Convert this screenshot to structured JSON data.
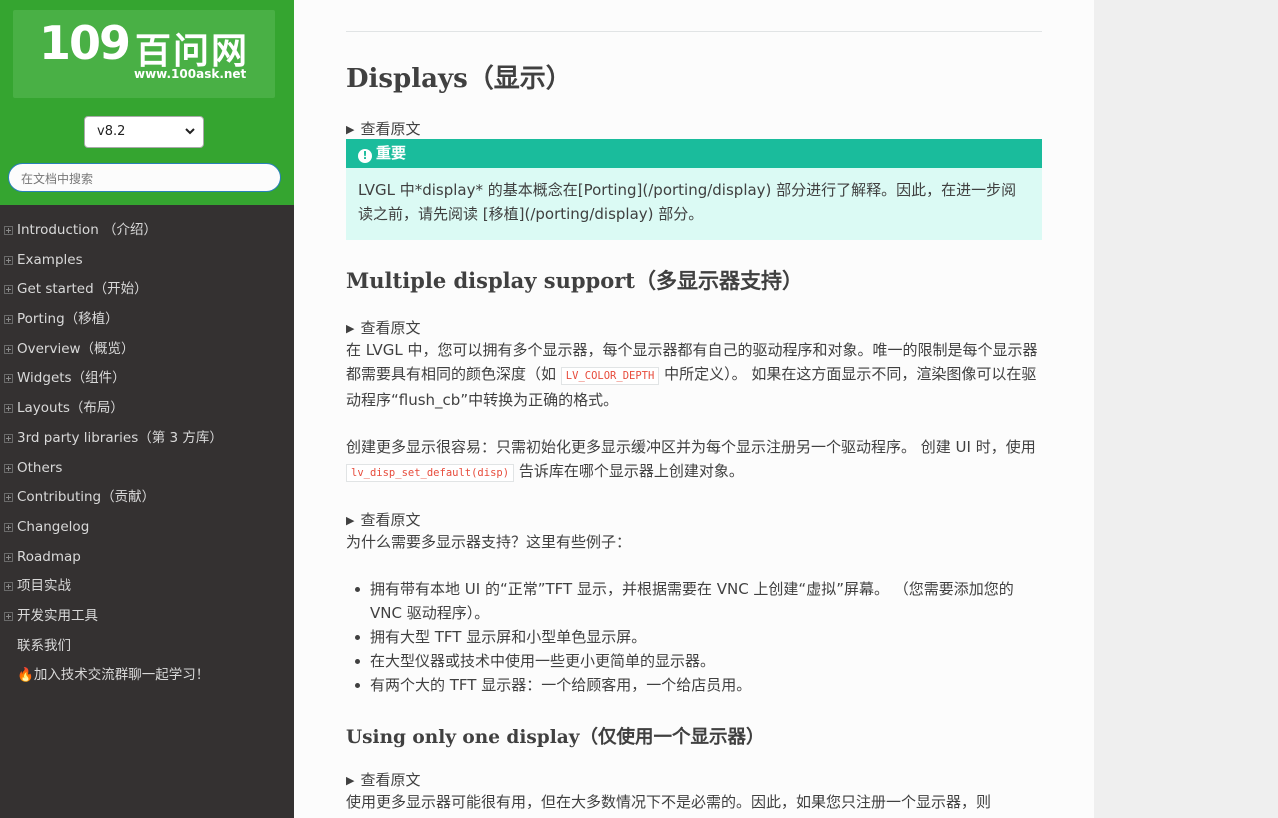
{
  "logo": {
    "number": "109",
    "name": "百问网",
    "url": "www.100ask.net"
  },
  "version": {
    "selected": "v8.2"
  },
  "search": {
    "placeholder": "在文档中搜索"
  },
  "nav": {
    "items": [
      {
        "label": "Introduction （介绍）",
        "expandable": true
      },
      {
        "label": "Examples",
        "expandable": true
      },
      {
        "label": "Get started（开始）",
        "expandable": true
      },
      {
        "label": "Porting（移植）",
        "expandable": true
      },
      {
        "label": "Overview（概览）",
        "expandable": true
      },
      {
        "label": "Widgets（组件）",
        "expandable": true
      },
      {
        "label": "Layouts（布局）",
        "expandable": true
      },
      {
        "label": "3rd party libraries（第 3 方库）",
        "expandable": true
      },
      {
        "label": "Others",
        "expandable": true
      },
      {
        "label": "Contributing（贡献）",
        "expandable": true
      },
      {
        "label": "Changelog",
        "expandable": true
      },
      {
        "label": "Roadmap",
        "expandable": true
      },
      {
        "label": "项目实战",
        "expandable": true
      },
      {
        "label": "开发实用工具",
        "expandable": true
      },
      {
        "label": "联系我们",
        "expandable": false
      },
      {
        "label": "加入技术交流群聊一起学习！",
        "expandable": false,
        "emoji": "🔥"
      }
    ]
  },
  "main": {
    "title": "Displays（显示）",
    "details_label": "查看原文",
    "admonition": {
      "title": "重要",
      "icon": "!",
      "body": "LVGL 中*display* 的基本概念在[Porting](/porting/display) 部分进行了解释。因此，在进一步阅读之前，请先阅读 [移植](/porting/display) 部分。"
    },
    "section1": {
      "heading": "Multiple display support（多显示器支持）",
      "p1_a": "在 LVGL 中，您可以拥有多个显示器，每个显示器都有自己的驱动程序和对象。唯一的限制是每个显示器都需要具有相同的颜色深度（如",
      "p1_code": "LV_COLOR_DEPTH",
      "p1_b": "中所定义）。 如果在这方面显示不同，渲染图像可以在驱动程序“flush_cb”中转换为正确的格式。",
      "p2_a": "创建更多显示很容易：只需初始化更多显示缓冲区并为每个显示注册另一个驱动程序。 创建 UI 时，使用",
      "p2_code": "lv_disp_set_default(disp)",
      "p2_b": "告诉库在哪个显示器上创建对象。",
      "p3": "为什么需要多显示器支持？这里有些例子：",
      "list": [
        "拥有带有本地 UI 的“正常”TFT 显示，并根据需要在 VNC 上创建“虚拟”屏幕。 （您需要添加您的 VNC 驱动程序）。",
        "拥有大型 TFT 显示屏和小型单色显示屏。",
        "在大型仪器或技术中使用一些更小更简单的显示器。",
        "有两个大的 TFT 显示器：一个给顾客用，一个给店员用。"
      ]
    },
    "section2": {
      "heading": "Using only one display（仅使用一个显示器）",
      "p1": "使用更多显示器可能很有用，但在大多数情况下不是必需的。因此，如果您只注册一个显示器，则"
    }
  },
  "colors": {
    "sidebar_bg": "#343131",
    "brand_green": "#35a530",
    "admonition_title": "#1abc9c",
    "admonition_bg": "#dbfaf4",
    "code_red": "#e74c3c"
  }
}
